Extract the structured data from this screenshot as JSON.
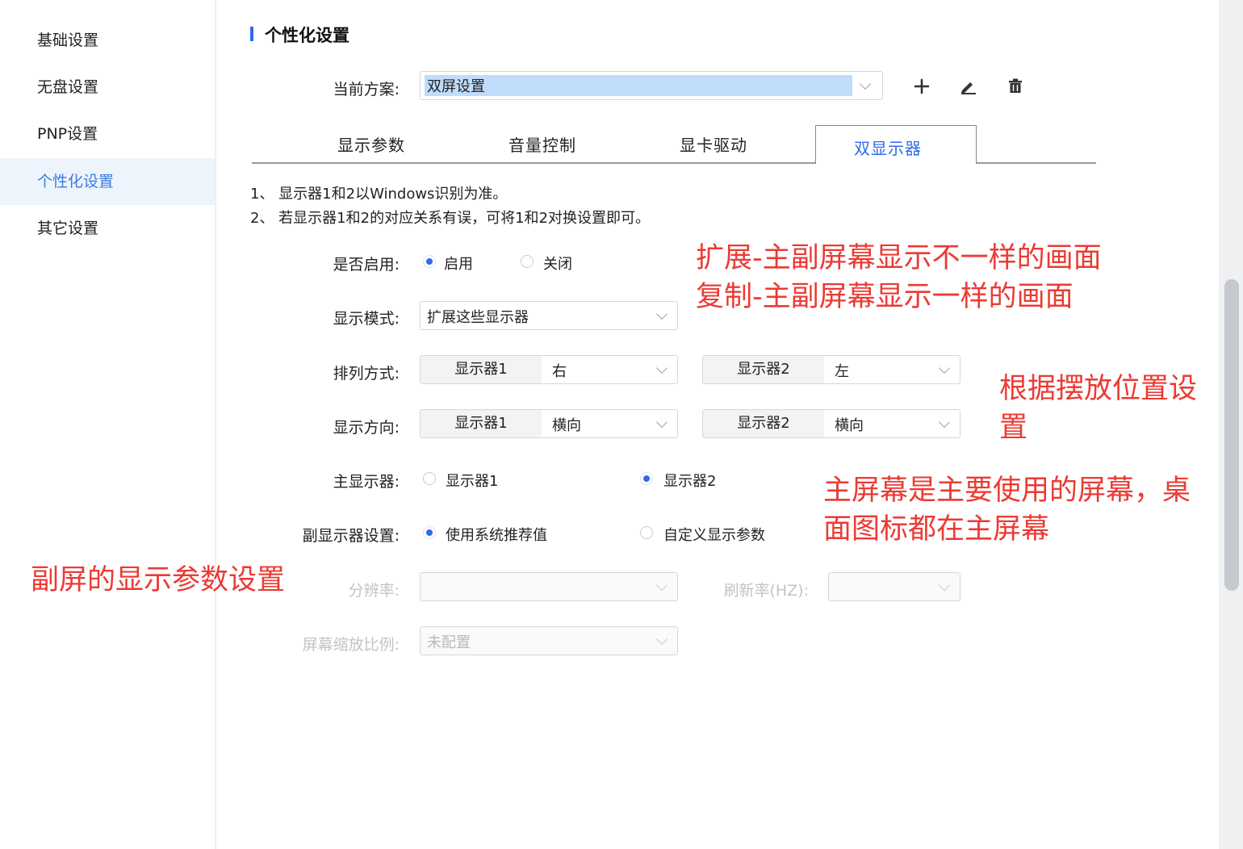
{
  "sidebar": {
    "items": [
      {
        "label": "基础设置",
        "active": false
      },
      {
        "label": "无盘设置",
        "active": false
      },
      {
        "label": "PNP设置",
        "active": false
      },
      {
        "label": "个性化设置",
        "active": true
      },
      {
        "label": "其它设置",
        "active": false
      }
    ]
  },
  "header": {
    "title": "个性化设置"
  },
  "scheme": {
    "label": "当前方案:",
    "value": "双屏设置",
    "actions": {
      "add_icon": "plus-icon",
      "edit_icon": "pencil-icon",
      "delete_icon": "trash-icon"
    }
  },
  "tabs": [
    {
      "label": "显示参数",
      "active": false
    },
    {
      "label": "音量控制",
      "active": false
    },
    {
      "label": "显卡驱动",
      "active": false
    },
    {
      "label": "双显示器",
      "active": true
    }
  ],
  "notes": [
    "1、 显示器1和2以Windows识别为准。",
    "2、 若显示器1和2的对应关系有误，可将1和2对换设置即可。"
  ],
  "form": {
    "enable": {
      "label": "是否启用:",
      "options": [
        "启用",
        "关闭"
      ],
      "selected": "启用"
    },
    "mode": {
      "label": "显示模式:",
      "value": "扩展这些显示器"
    },
    "arrange": {
      "label": "排列方式:",
      "monitor1": {
        "tag": "显示器1",
        "value": "右"
      },
      "monitor2": {
        "tag": "显示器2",
        "value": "左"
      }
    },
    "orientation": {
      "label": "显示方向:",
      "monitor1": {
        "tag": "显示器1",
        "value": "横向"
      },
      "monitor2": {
        "tag": "显示器2",
        "value": "横向"
      }
    },
    "primary": {
      "label": "主显示器:",
      "options": [
        "显示器1",
        "显示器2"
      ],
      "selected": "显示器2"
    },
    "secondary": {
      "label": "副显示器设置:",
      "options": [
        "使用系统推荐值",
        "自定义显示参数"
      ],
      "selected": "使用系统推荐值"
    },
    "resolution": {
      "label": "分辨率:",
      "value": ""
    },
    "refresh": {
      "label": "刷新率(HZ):",
      "value": ""
    },
    "scale": {
      "label": "屏幕缩放比例:",
      "value": "未配置"
    }
  },
  "annotations": {
    "mode_line1": "扩展-主副屏幕显示不一样的画面",
    "mode_line2": "复制-主副屏幕显示一样的画面",
    "position_line1": "根据摆放位置设",
    "position_line2": "置",
    "primary_line1": "主屏幕是主要使用的屏幕，桌",
    "primary_line2": "面图标都在主屏幕",
    "secondary": "副屏的显示参数设置"
  },
  "colors": {
    "accent": "#2f6be6",
    "annotation": "#ec3a34",
    "active_bg": "#eef4fc"
  }
}
